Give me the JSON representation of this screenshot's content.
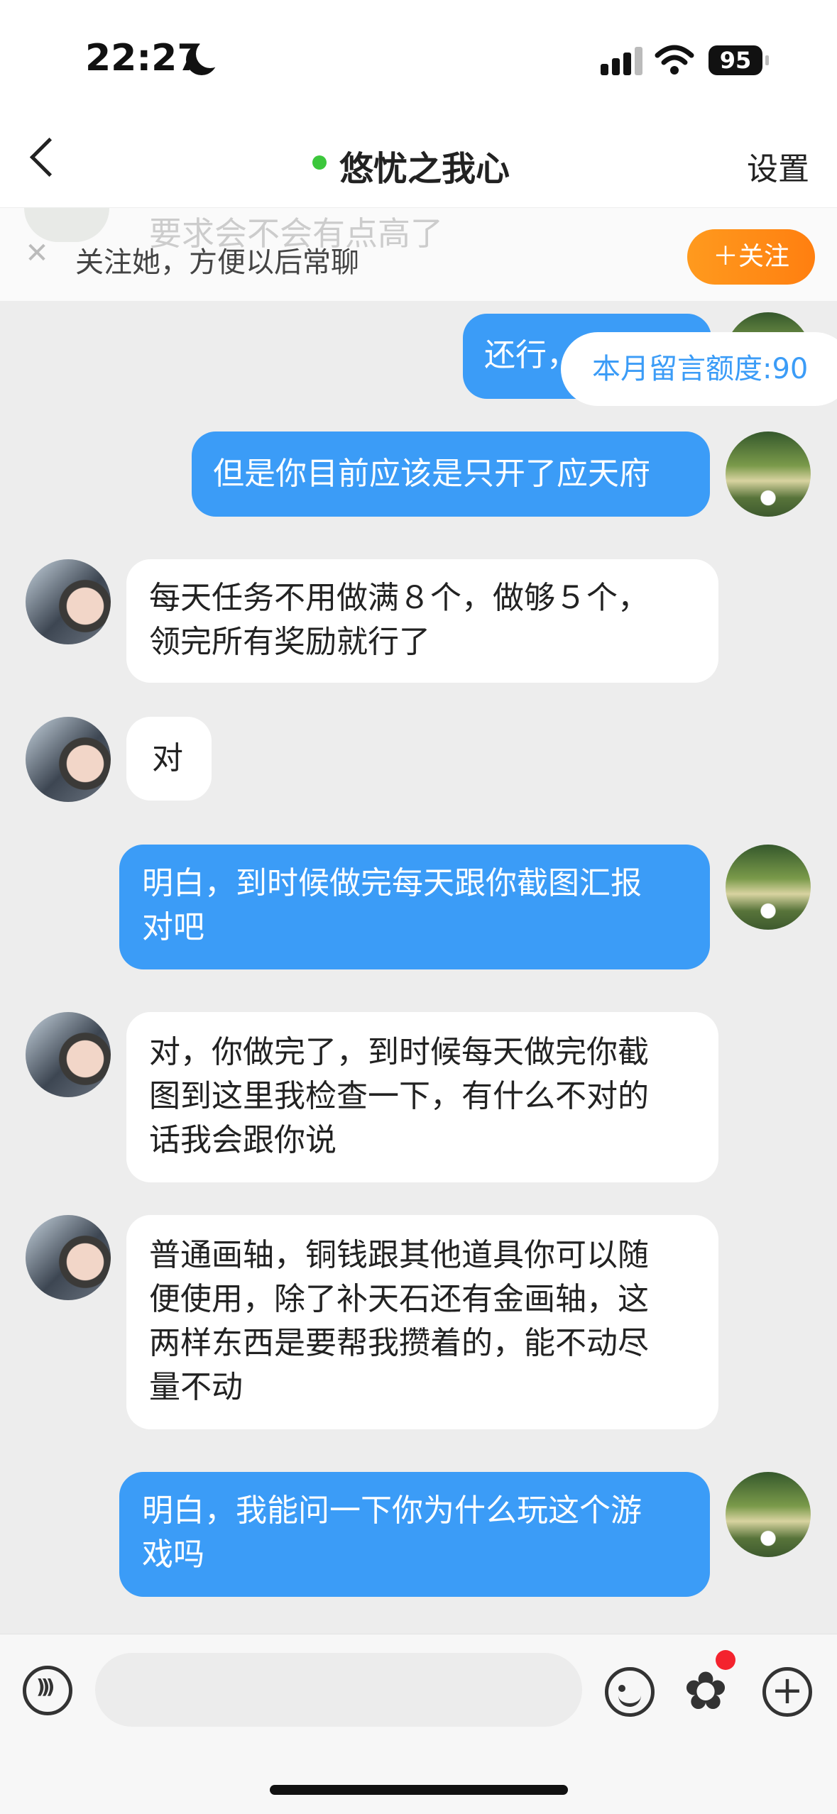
{
  "status_bar": {
    "time": "22:27",
    "battery": "95"
  },
  "nav": {
    "title": "悠忧之我心",
    "settings": "设置"
  },
  "follow_banner": {
    "ghost_text": "要求会不会有点高了",
    "text": "关注她，方便以后常聊",
    "button": "＋关注"
  },
  "quota": "本月留言额度:90",
  "messages": [
    {
      "from": "me",
      "text": "还行，"
    },
    {
      "from": "me",
      "text": "但是你目前应该是只开了应天府"
    },
    {
      "from": "her",
      "text": "每天任务不用做满８个，做够５个，\n领完所有奖励就行了"
    },
    {
      "from": "her",
      "text": "对"
    },
    {
      "from": "me",
      "text": "明白，到时候做完每天跟你截图汇报\n对吧"
    },
    {
      "from": "her",
      "text": "对，你做完了，到时候每天做完你截\n图到这里我检查一下，有什么不对的\n话我会跟你说"
    },
    {
      "from": "her",
      "text": "普通画轴，铜钱跟其他道具你可以随\n便使用，除了补天石还有金画轴，这\n两样东西是要帮我攒着的，能不动尽\n量不动"
    },
    {
      "from": "me",
      "text": "明白，我能问一下你为什么玩这个游\n戏吗"
    }
  ],
  "input": {
    "placeholder": ""
  },
  "colors": {
    "outgoing_bubble": "#3b9cf7",
    "incoming_bubble": "#ffffff",
    "follow_button": "#ff8a16",
    "online": "#3cc73c",
    "badge": "#f4232e"
  },
  "icons": [
    "back-chevron-icon",
    "close-icon",
    "voice-icon",
    "emoji-icon",
    "sticker-icon",
    "plus-icon",
    "signal-icon",
    "wifi-icon",
    "battery-icon",
    "moon-icon"
  ]
}
